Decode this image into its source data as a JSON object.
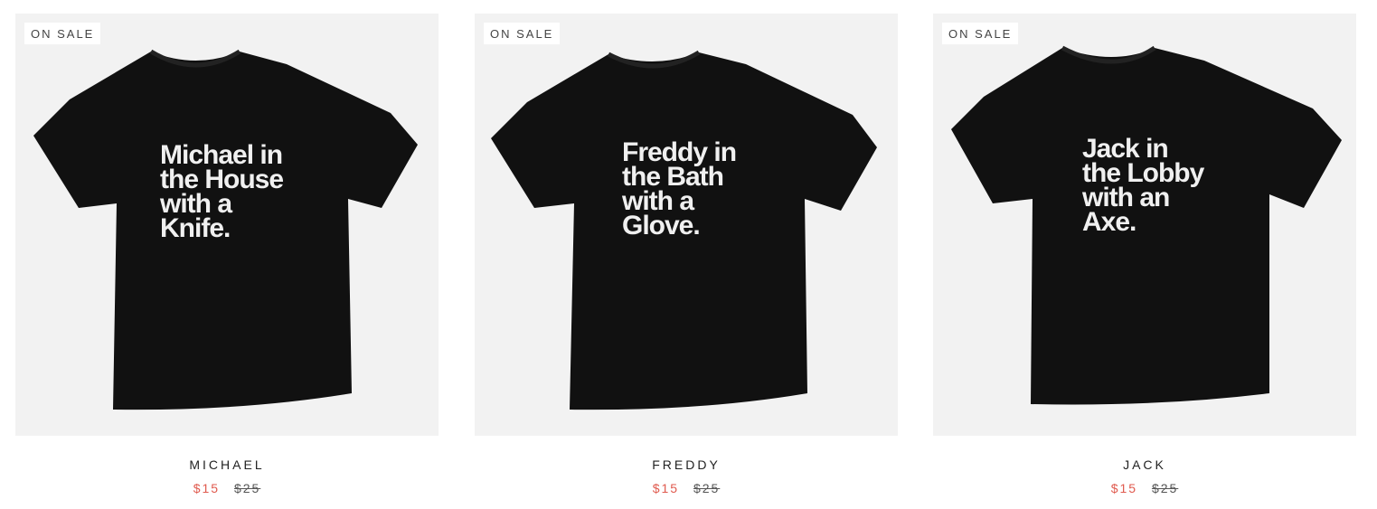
{
  "products": [
    {
      "badge": "ON SALE",
      "shirt_lines": [
        "Michael in",
        "the House",
        "with a",
        "Knife."
      ],
      "name": "MICHAEL",
      "sale_price": "$15",
      "original_price": "$25"
    },
    {
      "badge": "ON SALE",
      "shirt_lines": [
        "Freddy in",
        "the Bath",
        "with a",
        "Glove."
      ],
      "name": "FREDDY",
      "sale_price": "$15",
      "original_price": "$25"
    },
    {
      "badge": "ON SALE",
      "shirt_lines": [
        "Jack in",
        "the Lobby",
        "with an",
        "Axe."
      ],
      "name": "JACK",
      "sale_price": "$15",
      "original_price": "$25"
    }
  ],
  "colors": {
    "image_background": "#f2f2f2",
    "shirt": "#111111",
    "sale_price": "#e05a4e"
  }
}
